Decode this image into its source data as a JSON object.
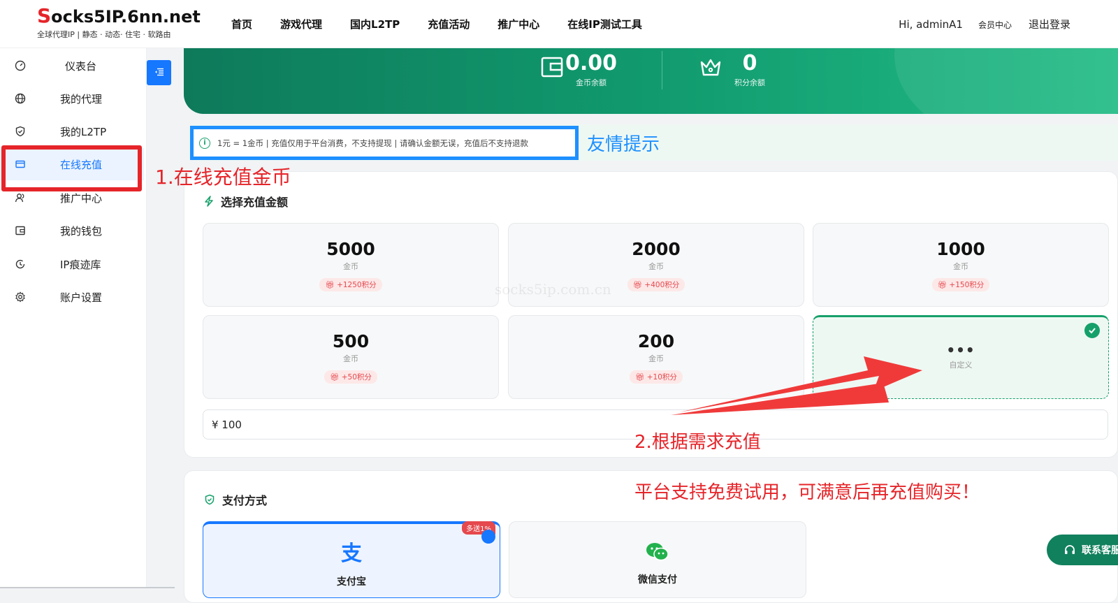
{
  "logo": {
    "first_letter": "S",
    "rest": "ocks5IP.6nn.net",
    "tagline": "全球代理IP | 静态 · 动态· 住宅 · 软路由"
  },
  "nav": [
    "首页",
    "游戏代理",
    "国内L2TP",
    "充值活动",
    "推广中心",
    "在线IP测试工具"
  ],
  "user": {
    "greeting": "Hi, adminA1",
    "member_center": "会员中心",
    "logout": "退出登录"
  },
  "sidebar": {
    "items": [
      {
        "label": "仪表台",
        "icon": "gauge-icon"
      },
      {
        "label": "我的代理",
        "icon": "globe-icon"
      },
      {
        "label": "我的L2TP",
        "icon": "shield-icon"
      },
      {
        "label": "在线充值",
        "icon": "card-icon",
        "active": true
      },
      {
        "label": "推广中心",
        "icon": "users-icon"
      },
      {
        "label": "我的钱包",
        "icon": "wallet-icon"
      },
      {
        "label": "IP痕迹库",
        "icon": "history-icon"
      },
      {
        "label": "账户设置",
        "icon": "gear-icon"
      }
    ]
  },
  "balance": {
    "coins": {
      "value": "0.00",
      "caption": "金币余额"
    },
    "points": {
      "value": "0",
      "caption": "积分余额"
    }
  },
  "tip": {
    "text": "1元 = 1金币 | 充值仅用于平台消费，不支持提现 | 请确认金额无误，充值后不支持退款",
    "annotation": "友情提示"
  },
  "recharge": {
    "title": "选择充值金额",
    "unit": "金币",
    "options": [
      {
        "amount": "5000",
        "bonus": "+1250积分"
      },
      {
        "amount": "2000",
        "bonus": "+400积分"
      },
      {
        "amount": "1000",
        "bonus": "+150积分"
      },
      {
        "amount": "500",
        "bonus": "+50积分"
      },
      {
        "amount": "200",
        "bonus": "+10积分"
      }
    ],
    "custom": {
      "dots": "•••",
      "label": "自定义"
    },
    "input_value": "¥ 100"
  },
  "payment": {
    "title": "支付方式",
    "methods": [
      {
        "label": "支付宝",
        "tag": "多送1%",
        "selected": true
      },
      {
        "label": "微信支付"
      }
    ]
  },
  "contact_button": "联系客服",
  "annotations": {
    "step1": "1.在线充值金币",
    "step2": "2.根据需求充值",
    "note": "平台支持免费试用，可满意后再充值购买！"
  },
  "watermark": "socks5ip.com.cn",
  "colors": {
    "primary_blue": "#1677ff",
    "green": "#15a06a",
    "red": "#e5252a"
  }
}
